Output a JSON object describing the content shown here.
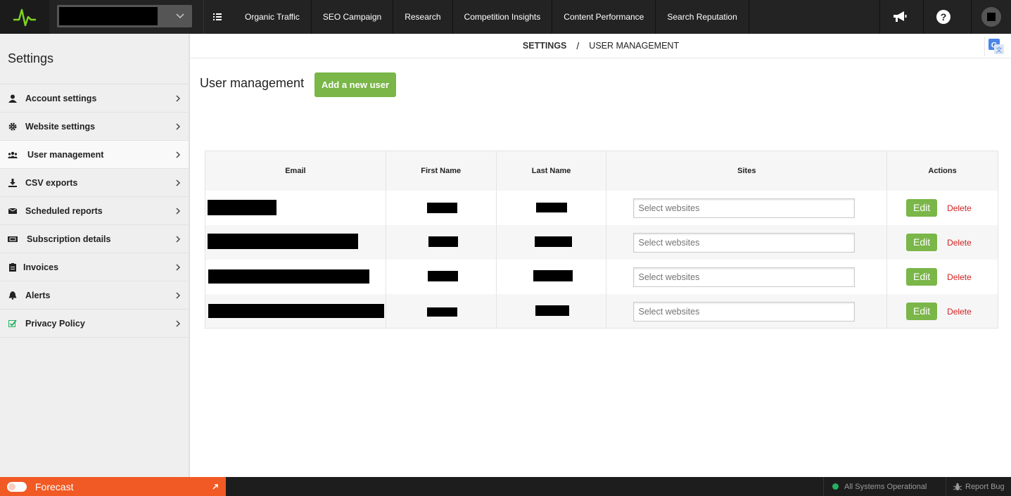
{
  "topbar": {
    "nav_items": [
      "Organic Traffic",
      "SEO Campaign",
      "Research",
      "Competition Insights",
      "Content Performance",
      "Search Reputation"
    ],
    "icons": [
      "list-icon",
      "megaphone-icon",
      "help-icon",
      "user-avatar"
    ]
  },
  "sidebar": {
    "title": "Settings",
    "items": [
      {
        "label": "Account settings",
        "icon": "user-icon"
      },
      {
        "label": "Website settings",
        "icon": "gear-icon"
      },
      {
        "label": "User management",
        "icon": "users-icon"
      },
      {
        "label": "CSV exports",
        "icon": "download-icon"
      },
      {
        "label": "Scheduled reports",
        "icon": "envelope-icon"
      },
      {
        "label": "Subscription details",
        "icon": "ticket-icon"
      },
      {
        "label": "Invoices",
        "icon": "clipboard-icon"
      },
      {
        "label": "Alerts",
        "icon": "bell-icon"
      },
      {
        "label": "Privacy Policy",
        "icon": "check-square-icon"
      }
    ]
  },
  "breadcrumb": {
    "root": "SETTINGS",
    "separator": "/",
    "current": "USER MANAGEMENT"
  },
  "main": {
    "title": "User management",
    "add_button": "Add a new user",
    "table": {
      "headers": [
        "Email",
        "First Name",
        "Last Name",
        "Sites",
        "Actions"
      ],
      "rows": [
        {
          "sites_placeholder": "Select websites",
          "edit": "Edit",
          "delete": "Delete"
        },
        {
          "sites_placeholder": "Select websites",
          "edit": "Edit",
          "delete": "Delete"
        },
        {
          "sites_placeholder": "Select websites",
          "edit": "Edit",
          "delete": "Delete"
        },
        {
          "sites_placeholder": "Select websites",
          "edit": "Edit",
          "delete": "Delete"
        }
      ]
    }
  },
  "footer": {
    "forecast": "Forecast",
    "status": "All Systems Operational",
    "report_bug": "Report Bug"
  },
  "colors": {
    "accent_green": "#7ab648",
    "forecast_orange": "#f15a24",
    "delete_red": "#d0201f",
    "status_green": "#27ae60"
  }
}
